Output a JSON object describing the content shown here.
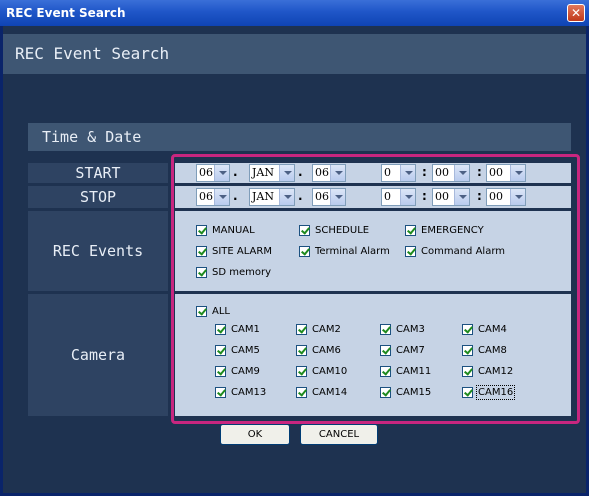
{
  "window": {
    "title": "REC Event Search",
    "close_glyph": "✕"
  },
  "header": {
    "title": "REC Event Search"
  },
  "section": {
    "title": "Time & Date"
  },
  "labels": {
    "start": "START",
    "stop": "STOP",
    "rec_events": "REC Events",
    "camera": "Camera"
  },
  "start": {
    "day": "06",
    "month": "JAN",
    "year": "06",
    "hour": "0",
    "minute": "00",
    "second": "00"
  },
  "stop": {
    "day": "06",
    "month": "JAN",
    "year": "06",
    "hour": "0",
    "minute": "00",
    "second": "00"
  },
  "separators": {
    "dot": ".",
    "colon": ":"
  },
  "rec_events": [
    {
      "label": "MANUAL",
      "checked": true
    },
    {
      "label": "SCHEDULE",
      "checked": true
    },
    {
      "label": "EMERGENCY",
      "checked": true
    },
    {
      "label": "SITE ALARM",
      "checked": true
    },
    {
      "label": "Terminal Alarm",
      "checked": true
    },
    {
      "label": "Command Alarm",
      "checked": true
    },
    {
      "label": "SD memory",
      "checked": true
    }
  ],
  "camera": {
    "all": {
      "label": "ALL",
      "checked": true
    },
    "cams": [
      "CAM1",
      "CAM2",
      "CAM3",
      "CAM4",
      "CAM5",
      "CAM6",
      "CAM7",
      "CAM8",
      "CAM9",
      "CAM10",
      "CAM11",
      "CAM12",
      "CAM13",
      "CAM14",
      "CAM15",
      "CAM16"
    ]
  },
  "buttons": {
    "ok": "OK",
    "cancel": "CANCEL"
  },
  "colors": {
    "accent": "#c8267f",
    "panel": "#c6d3e5",
    "label_bg": "#2e4362",
    "background": "#1e3250"
  }
}
